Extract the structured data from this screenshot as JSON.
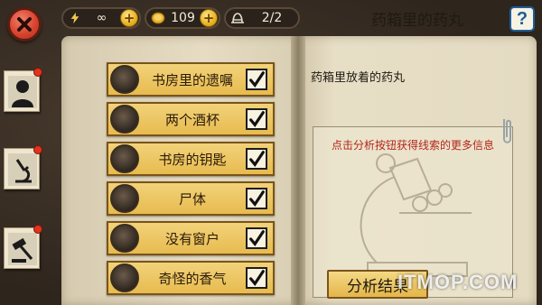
{
  "topbar": {
    "energy": {
      "icon": "lightning-icon",
      "value": "∞"
    },
    "coins": {
      "icon": "coin-icon",
      "value": "109"
    },
    "cases": {
      "icon": "hat-icon",
      "value": "2/2"
    },
    "help_label": "?"
  },
  "clues": [
    {
      "label": "书房里的遗嘱",
      "checked": true
    },
    {
      "label": "两个酒杯",
      "checked": true
    },
    {
      "label": "书房的钥匙",
      "checked": true
    },
    {
      "label": "尸体",
      "checked": true
    },
    {
      "label": "没有窗户",
      "checked": true
    },
    {
      "label": "奇怪的香气",
      "checked": true
    }
  ],
  "detail": {
    "title": "药箱里的药丸",
    "subtitle": "药箱里放着的药丸",
    "hint": "点击分析按钮获得线索的更多信息",
    "analyze_label": "分析结果"
  },
  "watermark": "ITMOP.COM",
  "colors": {
    "accent_gold": "#e7bb4f",
    "close_red": "#d9442e",
    "hint_red": "#b3261a",
    "help_blue": "#1c5e9a"
  }
}
